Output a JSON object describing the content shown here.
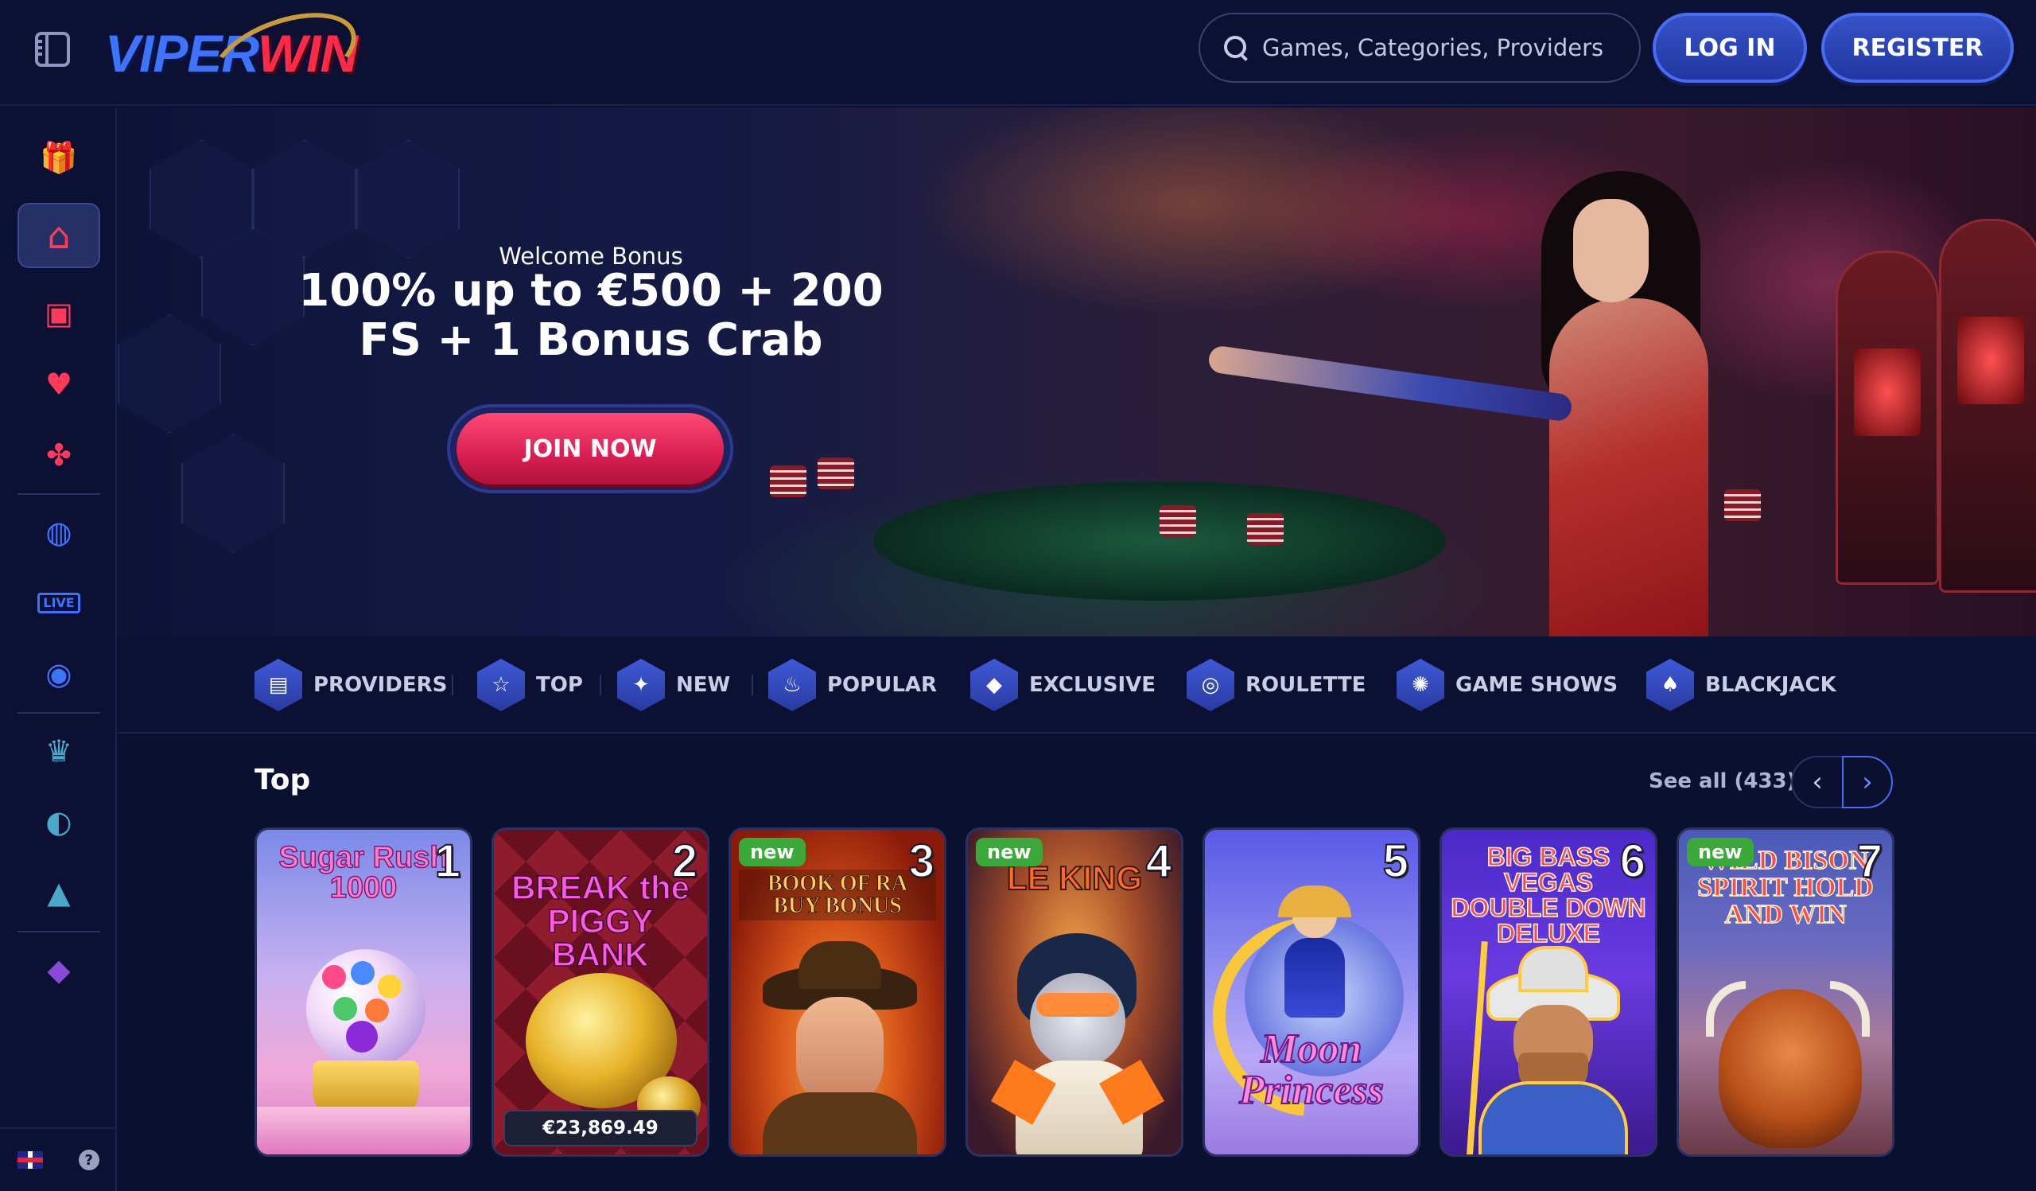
{
  "header": {
    "logo_part1": "VIPER",
    "logo_part2": "WIN",
    "search_placeholder": "Games, Categories, Providers",
    "login_label": "LOG IN",
    "register_label": "REGISTER"
  },
  "sidebar": {
    "items": [
      {
        "name": "gift-icon",
        "glyph": "🎁",
        "color": "#3ba84a"
      },
      {
        "name": "home-icon",
        "glyph": "⌂",
        "color": "#ff3a5a",
        "active": true
      },
      {
        "name": "slot-machine-icon",
        "glyph": "🎰",
        "color": "#ff3a5a"
      },
      {
        "name": "card-icon",
        "glyph": "♥",
        "color": "#ff3a5a"
      },
      {
        "name": "clover-icon",
        "glyph": "✤",
        "color": "#ff3a5a"
      },
      {
        "name": "sports-ball-icon",
        "glyph": "⚽",
        "color": "#3d73ff"
      },
      {
        "name": "live-icon",
        "glyph": "LIVE",
        "color": "#3d73ff"
      },
      {
        "name": "gamepad-icon",
        "glyph": "🎮",
        "color": "#3d73ff"
      },
      {
        "name": "trophy-icon",
        "glyph": "🏆",
        "color": "#4aa8c8"
      },
      {
        "name": "wave-icon",
        "glyph": "◐",
        "color": "#4aa8c8"
      },
      {
        "name": "lock-icon",
        "glyph": "🔒",
        "color": "#4aa8c8"
      },
      {
        "name": "diamond-icon",
        "glyph": "💎",
        "color": "#8a4ad8"
      }
    ],
    "help_label": "?"
  },
  "hero": {
    "subtitle": "Welcome Bonus",
    "title_line1": "100% up to €500 + 200",
    "title_line2": "FS + 1 Bonus Crab",
    "cta_label": "JOIN NOW"
  },
  "categories": [
    {
      "label": "PROVIDERS",
      "icon": "providers-icon",
      "glyph": "▤"
    },
    {
      "label": "TOP",
      "icon": "star-icon",
      "glyph": "☆"
    },
    {
      "label": "NEW",
      "icon": "new-icon",
      "glyph": "✦"
    },
    {
      "label": "POPULAR",
      "icon": "flame-icon",
      "glyph": "♨"
    },
    {
      "label": "EXCLUSIVE",
      "icon": "diamond-icon",
      "glyph": "◆"
    },
    {
      "label": "ROULETTE",
      "icon": "roulette-icon",
      "glyph": "◎"
    },
    {
      "label": "GAME SHOWS",
      "icon": "game-shows-icon",
      "glyph": "✺"
    },
    {
      "label": "BLACKJACK",
      "icon": "blackjack-icon",
      "glyph": "♠"
    }
  ],
  "top_section": {
    "title": "Top",
    "see_all": "See all (433)",
    "games": [
      {
        "rank": "1",
        "art_title": "Sugar Rush 1000",
        "new": false,
        "jackpot": ""
      },
      {
        "rank": "2",
        "art_title": "BREAK the PIGGY BANK",
        "new": false,
        "jackpot": "€23,869.49"
      },
      {
        "rank": "3",
        "art_title": "BOOK OF RA BUY BONUS",
        "new": true,
        "jackpot": ""
      },
      {
        "rank": "4",
        "art_title": "LE KING",
        "new": true,
        "jackpot": ""
      },
      {
        "rank": "5",
        "art_title": "Moon Princess",
        "new": false,
        "jackpot": ""
      },
      {
        "rank": "6",
        "art_title": "BIG BASS VEGAS DOUBLE DOWN DELUXE",
        "new": false,
        "jackpot": ""
      },
      {
        "rank": "7",
        "art_title": "WILD BISON SPIRIT HOLD AND WIN",
        "new": true,
        "jackpot": ""
      }
    ],
    "new_badge": "new"
  }
}
